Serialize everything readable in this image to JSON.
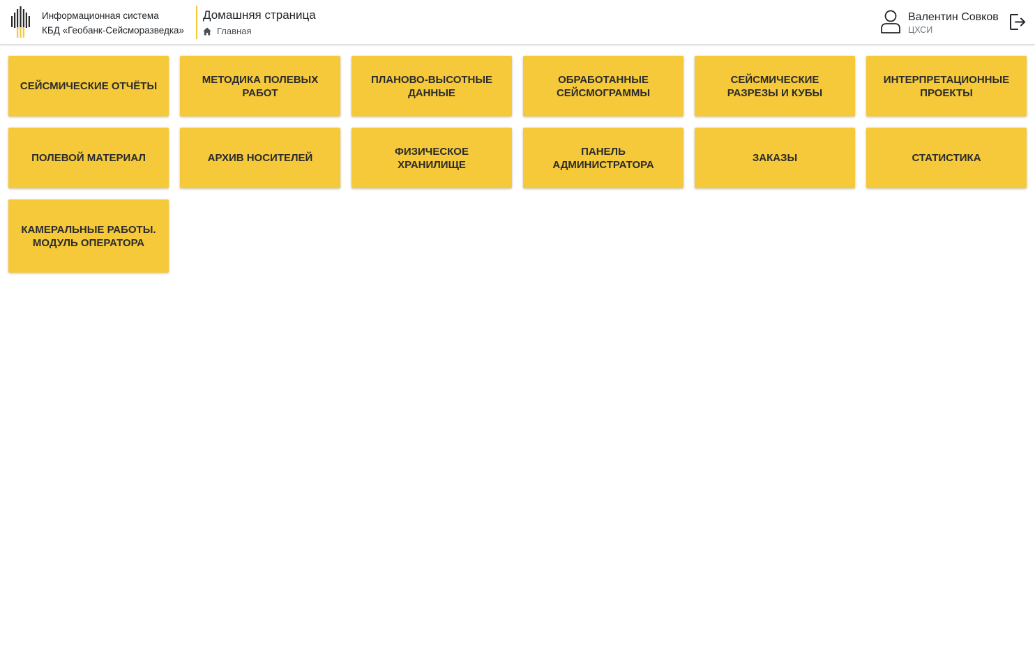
{
  "header": {
    "system_name_line1": "Информационная система",
    "system_name_line2": "КБД «Геобанк-Сейсморазведка»",
    "page_title": "Домашняя страница",
    "breadcrumb_home": "Главная",
    "icons": {
      "logo": "company-logo-icon",
      "home": "home-icon",
      "user": "user-icon",
      "logout": "logout-icon"
    }
  },
  "user": {
    "name": "Валентин Совков",
    "department": "ЦХСИ"
  },
  "colors": {
    "tile_background": "#f5c93a",
    "accent_divider": "#f5c933",
    "logo_dark": "#2a2a2a",
    "logo_yellow": "#f5c933"
  },
  "tiles": [
    {
      "label": "СЕЙСМИЧЕСКИЕ ОТЧЁТЫ"
    },
    {
      "label": "МЕТОДИКА ПОЛЕВЫХ РАБОТ"
    },
    {
      "label": "ПЛАНОВО-ВЫСОТНЫЕ ДАННЫЕ"
    },
    {
      "label": "ОБРАБОТАННЫЕ СЕЙСМОГРАММЫ"
    },
    {
      "label": "СЕЙСМИЧЕСКИЕ РАЗРЕЗЫ И КУБЫ"
    },
    {
      "label": "ИНТЕРПРЕТАЦИОННЫЕ ПРОЕКТЫ"
    },
    {
      "label": "ПОЛЕВОЙ МАТЕРИАЛ"
    },
    {
      "label": "АРХИВ НОСИТЕЛЕЙ"
    },
    {
      "label": "ФИЗИЧЕСКОЕ ХРАНИЛИЩЕ"
    },
    {
      "label": "ПАНЕЛЬ АДМИНИСТРАТОРА"
    },
    {
      "label": "ЗАКАЗЫ"
    },
    {
      "label": "СТАТИСТИКА"
    },
    {
      "label": "КАМЕРАЛЬНЫЕ РАБОТЫ. МОДУЛЬ ОПЕРАТОРА"
    }
  ]
}
